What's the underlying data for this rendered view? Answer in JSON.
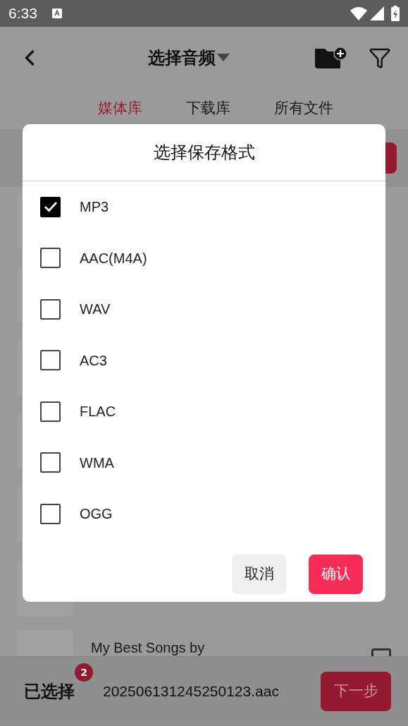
{
  "status_bar": {
    "time": "6:33"
  },
  "app_bar": {
    "title": "选择音频"
  },
  "tabs": [
    {
      "label": "媒体库",
      "selected": true
    },
    {
      "label": "下载库",
      "selected": false
    },
    {
      "label": "所有文件",
      "selected": false
    }
  ],
  "file_list": {
    "rows": [
      {
        "title": "My Best Songs by",
        "checked": false
      }
    ]
  },
  "bottom_bar": {
    "label": "已选择",
    "count": "2",
    "file": "202506131245250123.aac",
    "next_button": "下一步"
  },
  "dialog": {
    "title": "选择保存格式",
    "options": [
      {
        "label": "MP3",
        "checked": true
      },
      {
        "label": "AAC(M4A)",
        "checked": false
      },
      {
        "label": "WAV",
        "checked": false
      },
      {
        "label": "AC3",
        "checked": false
      },
      {
        "label": "FLAC",
        "checked": false
      },
      {
        "label": "WMA",
        "checked": false
      },
      {
        "label": "OGG",
        "checked": false
      }
    ],
    "cancel_button": "取消",
    "confirm_button": "确认"
  }
}
